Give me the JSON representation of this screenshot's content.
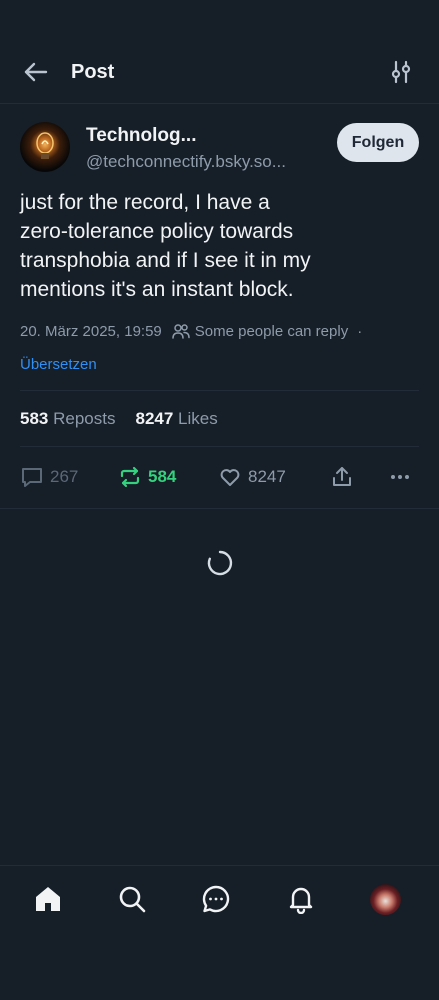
{
  "header": {
    "back_icon": "arrow-left-icon",
    "title": "Post",
    "settings_icon": "sliders-icon"
  },
  "post": {
    "author_name": "Technolog...",
    "author_handle": "@techconnectify.bsky.so...",
    "follow_label": "Folgen",
    "text": "just for the record, I have a\nzero-tolerance policy towards\ntransphobia and if I see it in my\nmentions it's an instant block.",
    "timestamp": "20. März 2025, 19:59",
    "reply_restriction": "Some people can reply",
    "meta_separator": "·",
    "translate_label": "Übersetzen",
    "stats": {
      "reposts_count": "583",
      "reposts_label": "Reposts",
      "likes_count": "8247",
      "likes_label": "Likes"
    },
    "actions": {
      "reply_count": "267",
      "repost_count": "584",
      "like_count": "8247"
    }
  },
  "bottom_nav": {
    "items": [
      "home-icon",
      "search-icon",
      "chat-icon",
      "bell-icon",
      "profile-avatar"
    ]
  },
  "colors": {
    "background": "#161e27",
    "divider": "#222c38",
    "text_primary": "#f1f3f5",
    "text_secondary": "#8d9bab",
    "link": "#2f8ff5",
    "repost_active": "#34d17e",
    "follow_button_bg": "#dfe5ec"
  }
}
